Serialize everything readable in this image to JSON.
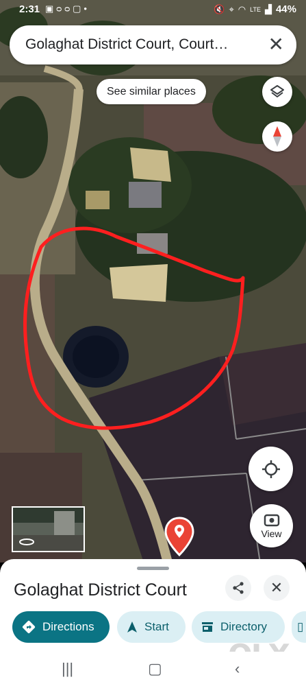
{
  "status_bar": {
    "time": "2:31",
    "battery": "44%",
    "left_icons": [
      "gallery-icon",
      "voicemail-icon",
      "app-icon",
      "dot-icon"
    ],
    "right_icons": [
      "mute-icon",
      "location-icon",
      "wifi-icon",
      "volte-icon",
      "signal-icon"
    ]
  },
  "search": {
    "query": "Golaghat District Court, Court…",
    "close_icon": "close-icon"
  },
  "map": {
    "similar_places_label": "See similar places",
    "view_label": "View",
    "layers_icon": "layers-icon",
    "compass_icon": "compass-icon",
    "locate_icon": "my-location-icon",
    "pin_color": "#ea4335"
  },
  "place_sheet": {
    "title": "Golaghat District Court",
    "actions": [
      {
        "label": "Directions",
        "icon": "directions-icon"
      },
      {
        "label": "Start",
        "icon": "navigation-arrow-icon"
      },
      {
        "label": "Directory",
        "icon": "store-icon"
      },
      {
        "label": "",
        "icon": "more-icon"
      }
    ]
  },
  "watermark": "OLX",
  "colors": {
    "primary": "#0b7484",
    "chip_bg": "#dbeff4",
    "annotation": "#ff1f1f"
  }
}
